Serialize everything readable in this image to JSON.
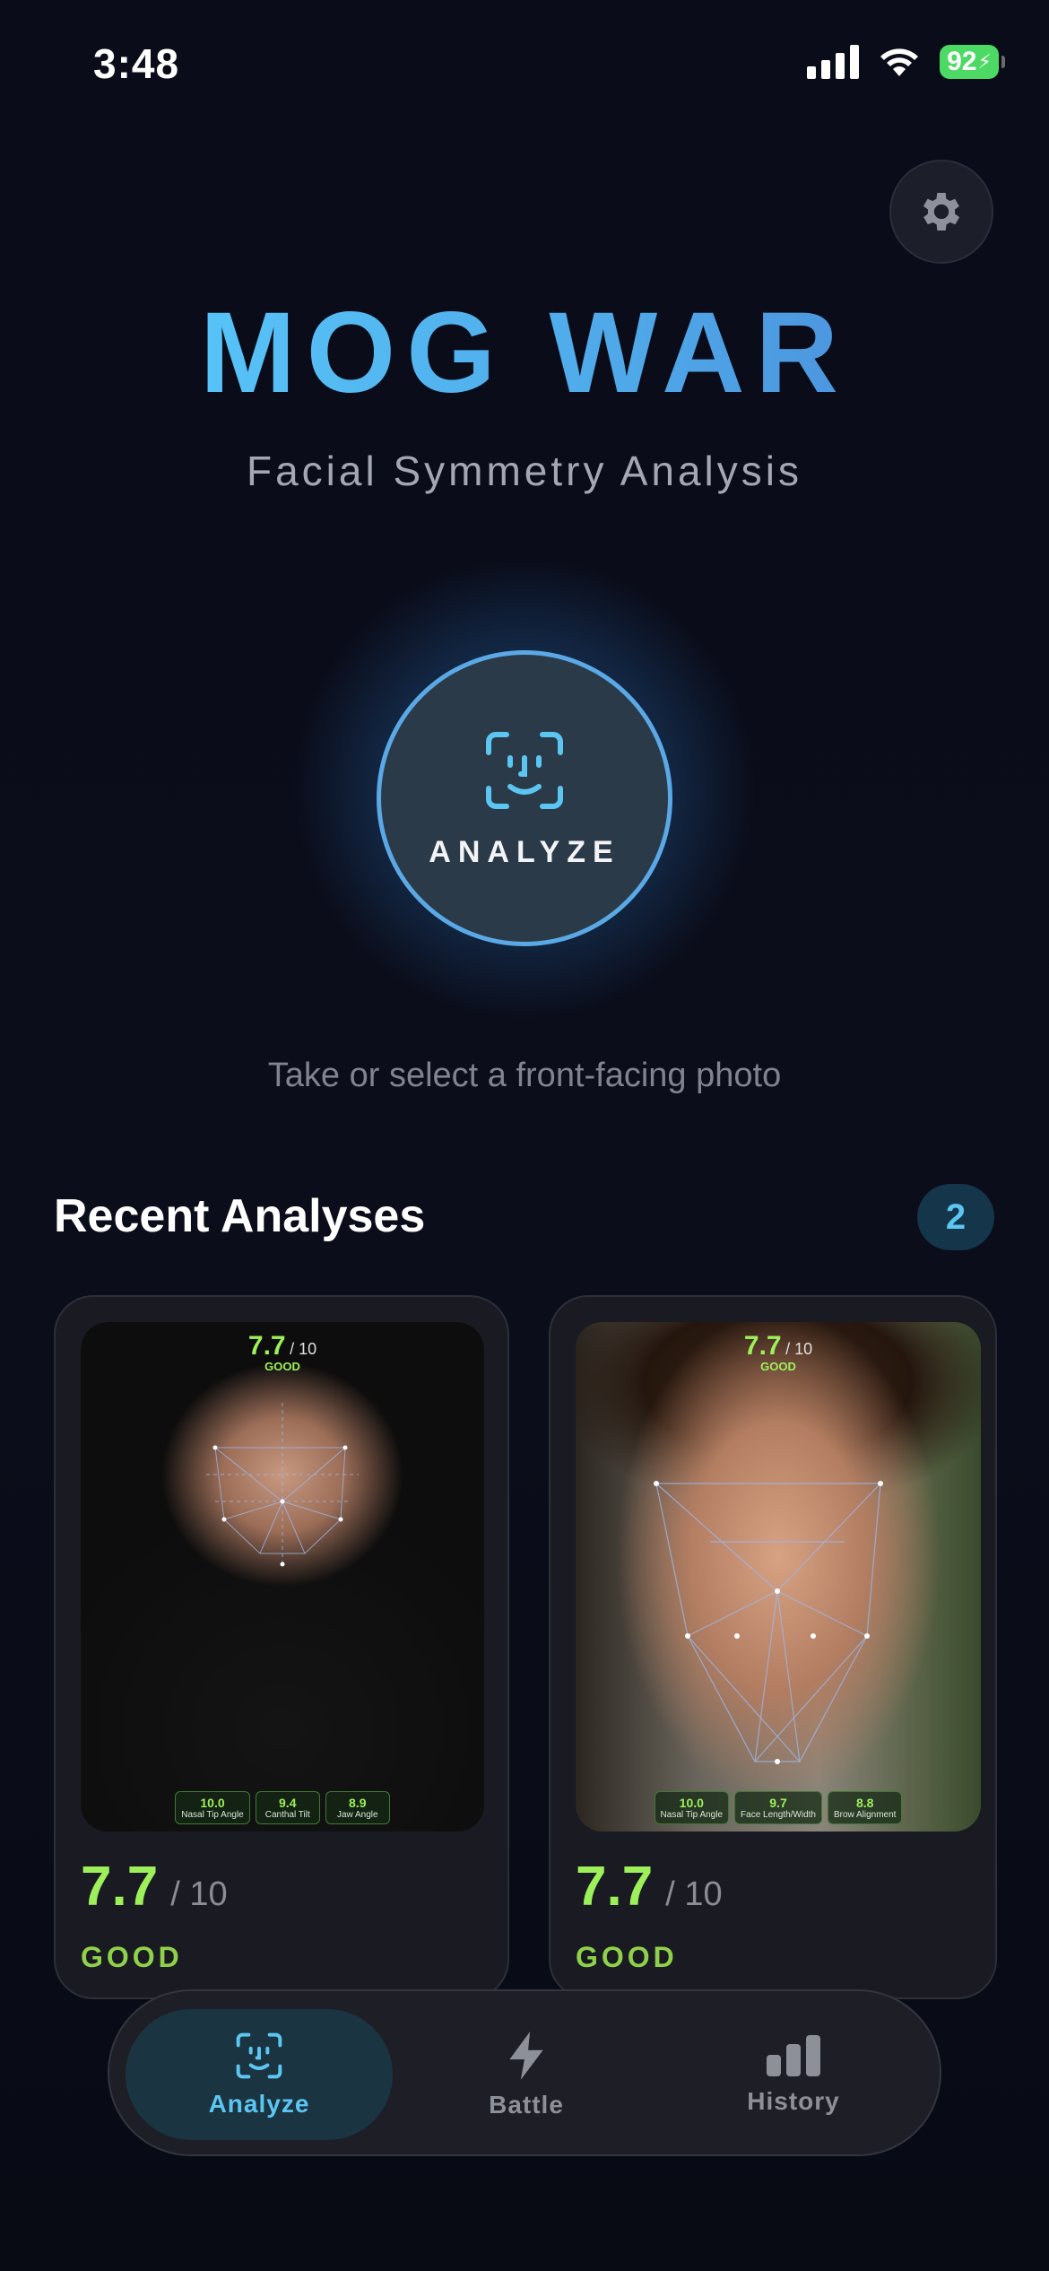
{
  "status_bar": {
    "time": "3:48",
    "battery": "92"
  },
  "header": {
    "title": "MOG WAR",
    "subtitle": "Facial Symmetry Analysis"
  },
  "analyze": {
    "label": "ANALYZE",
    "hint": "Take or select a front-facing photo"
  },
  "recent": {
    "title": "Recent Analyses",
    "count": "2",
    "items": [
      {
        "score": "7.7",
        "out_of": "/ 10",
        "rating": "GOOD",
        "overlay_score": "7.7",
        "overlay_out_of": "/ 10",
        "overlay_rating": "GOOD",
        "metrics": [
          {
            "value": "10.0",
            "label": "Nasal Tip Angle"
          },
          {
            "value": "9.4",
            "label": "Canthal Tilt"
          },
          {
            "value": "8.9",
            "label": "Jaw Angle"
          }
        ]
      },
      {
        "score": "7.7",
        "out_of": "/ 10",
        "rating": "GOOD",
        "overlay_score": "7.7",
        "overlay_out_of": "/ 10",
        "overlay_rating": "GOOD",
        "metrics": [
          {
            "value": "10.0",
            "label": "Nasal Tip Angle"
          },
          {
            "value": "9.7",
            "label": "Face Length/Width"
          },
          {
            "value": "8.8",
            "label": "Brow Alignment"
          }
        ]
      }
    ]
  },
  "tabs": [
    {
      "label": "Analyze",
      "icon": "face-id-icon",
      "active": true
    },
    {
      "label": "Battle",
      "icon": "bolt-icon",
      "active": false
    },
    {
      "label": "History",
      "icon": "bar-chart-icon",
      "active": false
    }
  ],
  "colors": {
    "accent": "#5bc6f2",
    "score_green": "#9ef05a",
    "background": "#0a0c18"
  }
}
